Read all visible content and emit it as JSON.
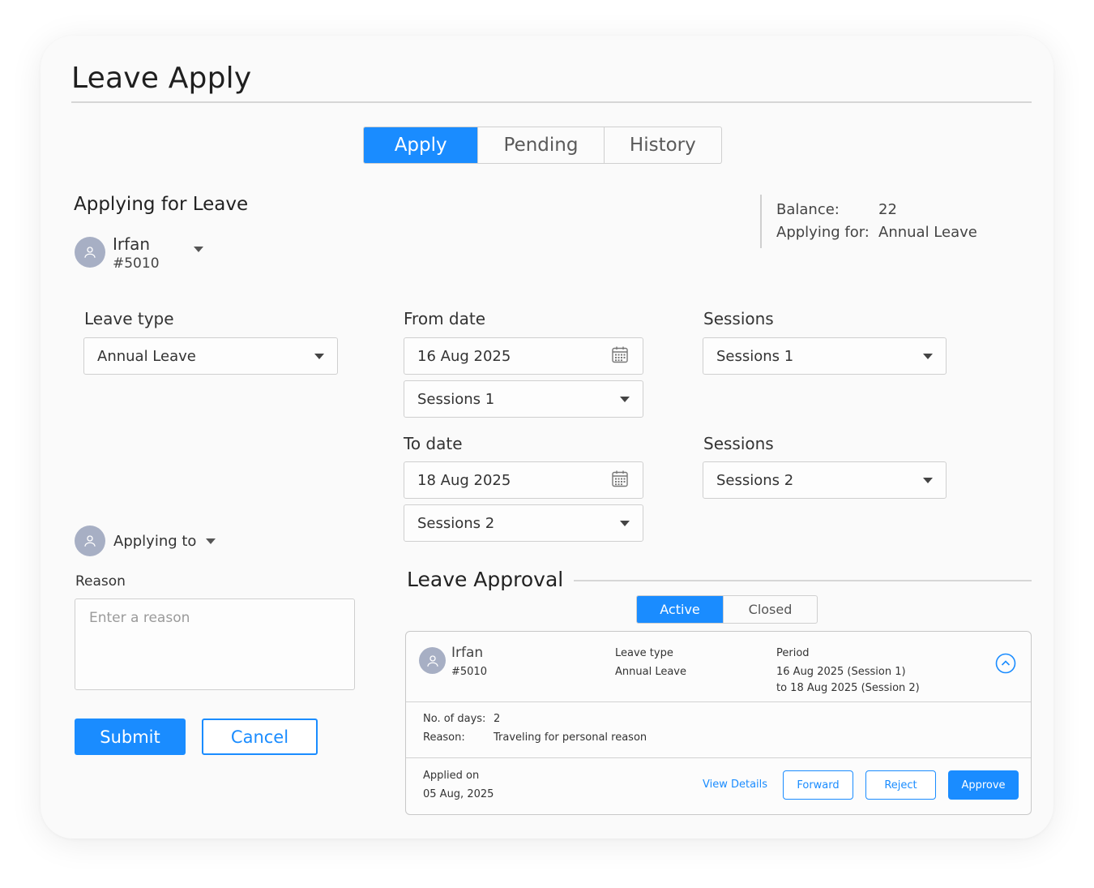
{
  "page": {
    "title": "Leave Apply"
  },
  "tabs": [
    {
      "label": "Apply",
      "active": true
    },
    {
      "label": "Pending",
      "active": false
    },
    {
      "label": "History",
      "active": false
    }
  ],
  "applying_for": {
    "heading": "Applying for Leave",
    "employee": {
      "name": "Irfan",
      "id": "#5010"
    }
  },
  "balance": {
    "balance_label": "Balance:",
    "balance_value": "22",
    "applying_for_label": "Applying for:",
    "applying_for_value": "Annual Leave"
  },
  "form": {
    "leave_type": {
      "label": "Leave type",
      "value": "Annual Leave"
    },
    "from_date": {
      "label": "From date",
      "value": "16 Aug 2025",
      "session": "Sessions 1"
    },
    "to_date": {
      "label": "To date",
      "value": "18 Aug 2025",
      "session": "Sessions 2"
    },
    "sessions_from": {
      "label": "Sessions",
      "value": "Sessions 1"
    },
    "sessions_to": {
      "label": "Sessions",
      "value": "Sessions 2"
    },
    "applying_to": {
      "label": "Applying to"
    },
    "reason": {
      "label": "Reason",
      "placeholder": "Enter a reason",
      "value": ""
    },
    "submit_label": "Submit",
    "cancel_label": "Cancel"
  },
  "approval": {
    "heading": "Leave Approval",
    "tabs": [
      {
        "label": "Active",
        "active": true
      },
      {
        "label": "Closed",
        "active": false
      }
    ],
    "card": {
      "name": "Irfan",
      "id": "#5010",
      "leave_type_label": "Leave type",
      "leave_type_value": "Annual Leave",
      "period_label": "Period",
      "period_from": "16 Aug 2025 (Session 1)",
      "period_to": "to 18 Aug 2025 (Session 2)",
      "days_label": "No. of days:",
      "days_value": "2",
      "reason_label": "Reason:",
      "reason_value": "Traveling for personal reason",
      "applied_on_label": "Applied on",
      "applied_on_value": "05 Aug, 2025",
      "view_details_label": "View Details",
      "forward_label": "Forward",
      "reject_label": "Reject",
      "approve_label": "Approve"
    }
  },
  "colors": {
    "accent": "#1a8cff",
    "avatar": "#a7afc4",
    "border": "#cfcfcf"
  },
  "icons": [
    "user-icon",
    "chevron-down-icon",
    "calendar-icon",
    "chevron-up-circle-icon"
  ]
}
